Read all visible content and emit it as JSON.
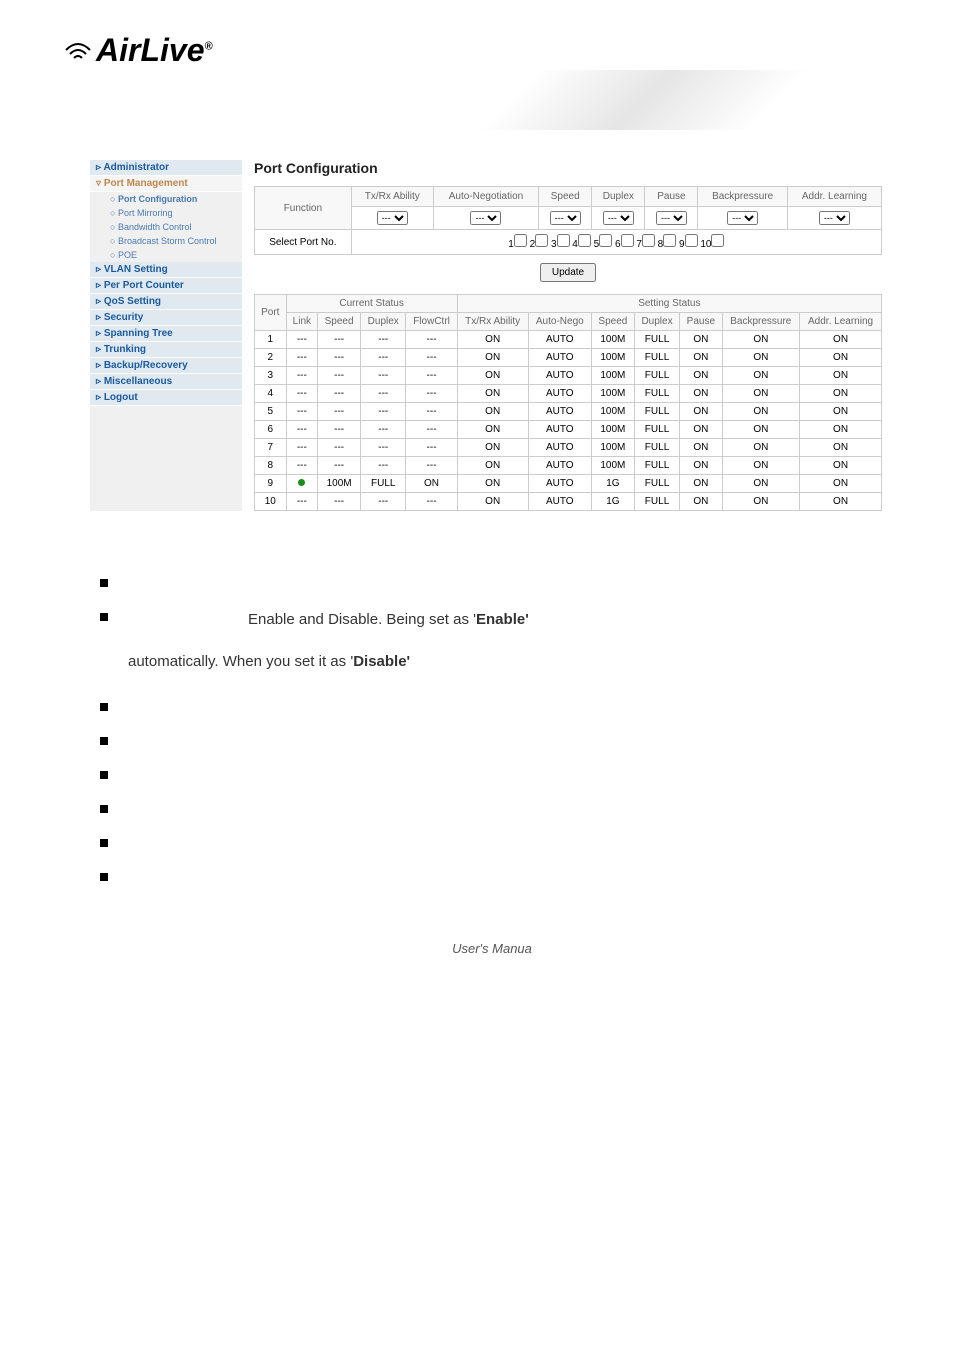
{
  "logo": {
    "text": "AirLive",
    "r": "®"
  },
  "sidebar": {
    "items": [
      {
        "label": "Administrator",
        "cls": "top"
      },
      {
        "label": "Port Management",
        "cls": "top active"
      }
    ],
    "subs": [
      "Port Configuration",
      "Port Mirroring",
      "Bandwidth Control",
      "Broadcast Storm Control",
      "POE"
    ],
    "items2": [
      "VLAN Setting",
      "Per Port Counter",
      "QoS Setting",
      "Security",
      "Spanning Tree",
      "Trunking",
      "Backup/Recovery",
      "Miscellaneous",
      "Logout"
    ]
  },
  "panel": {
    "title": "Port Configuration",
    "func_headers": [
      "Tx/Rx Ability",
      "Auto-Negotiation",
      "Speed",
      "Duplex",
      "Pause",
      "Backpressure",
      "Addr. Learning"
    ],
    "func_label": "Function",
    "select_label": "Select Port No.",
    "dropdown_val": "---",
    "port_check_label": [
      "1",
      "2",
      "3",
      "4",
      "5",
      "6",
      "7",
      "8",
      "9",
      "10"
    ],
    "update_btn": "Update",
    "status_groups": [
      "Current Status",
      "Setting Status"
    ],
    "status_headers": [
      "Port",
      "Link",
      "Speed",
      "Duplex",
      "FlowCtrl",
      "Tx/Rx Ability",
      "Auto-Nego",
      "Speed",
      "Duplex",
      "Pause",
      "Backpressure",
      "Addr. Learning"
    ],
    "rows": [
      {
        "port": "1",
        "link": "---",
        "speed": "---",
        "duplex": "---",
        "flow": "---",
        "txrx": "ON",
        "auto": "AUTO",
        "sspeed": "100M",
        "sduplex": "FULL",
        "pause": "ON",
        "bp": "ON",
        "addr": "ON"
      },
      {
        "port": "2",
        "link": "---",
        "speed": "---",
        "duplex": "---",
        "flow": "---",
        "txrx": "ON",
        "auto": "AUTO",
        "sspeed": "100M",
        "sduplex": "FULL",
        "pause": "ON",
        "bp": "ON",
        "addr": "ON"
      },
      {
        "port": "3",
        "link": "---",
        "speed": "---",
        "duplex": "---",
        "flow": "---",
        "txrx": "ON",
        "auto": "AUTO",
        "sspeed": "100M",
        "sduplex": "FULL",
        "pause": "ON",
        "bp": "ON",
        "addr": "ON"
      },
      {
        "port": "4",
        "link": "---",
        "speed": "---",
        "duplex": "---",
        "flow": "---",
        "txrx": "ON",
        "auto": "AUTO",
        "sspeed": "100M",
        "sduplex": "FULL",
        "pause": "ON",
        "bp": "ON",
        "addr": "ON"
      },
      {
        "port": "5",
        "link": "---",
        "speed": "---",
        "duplex": "---",
        "flow": "---",
        "txrx": "ON",
        "auto": "AUTO",
        "sspeed": "100M",
        "sduplex": "FULL",
        "pause": "ON",
        "bp": "ON",
        "addr": "ON"
      },
      {
        "port": "6",
        "link": "---",
        "speed": "---",
        "duplex": "---",
        "flow": "---",
        "txrx": "ON",
        "auto": "AUTO",
        "sspeed": "100M",
        "sduplex": "FULL",
        "pause": "ON",
        "bp": "ON",
        "addr": "ON"
      },
      {
        "port": "7",
        "link": "---",
        "speed": "---",
        "duplex": "---",
        "flow": "---",
        "txrx": "ON",
        "auto": "AUTO",
        "sspeed": "100M",
        "sduplex": "FULL",
        "pause": "ON",
        "bp": "ON",
        "addr": "ON"
      },
      {
        "port": "8",
        "link": "---",
        "speed": "---",
        "duplex": "---",
        "flow": "---",
        "txrx": "ON",
        "auto": "AUTO",
        "sspeed": "100M",
        "sduplex": "FULL",
        "pause": "ON",
        "bp": "ON",
        "addr": "ON"
      },
      {
        "port": "9",
        "link": "green",
        "speed": "100M",
        "duplex": "FULL",
        "flow": "ON",
        "txrx": "ON",
        "auto": "AUTO",
        "sspeed": "1G",
        "sduplex": "FULL",
        "pause": "ON",
        "bp": "ON",
        "addr": "ON"
      },
      {
        "port": "10",
        "link": "---",
        "speed": "---",
        "duplex": "---",
        "flow": "---",
        "txrx": "ON",
        "auto": "AUTO",
        "sspeed": "1G",
        "sduplex": "FULL",
        "pause": "ON",
        "bp": "ON",
        "addr": "ON"
      }
    ]
  },
  "bullets": {
    "b1_pre": "Enable and Disable. Being set as '",
    "b1_bold": "Enable'",
    "b2_pre": "automatically. When you set it as '",
    "b2_bold": "Disable'"
  },
  "footer": "User's Manua"
}
